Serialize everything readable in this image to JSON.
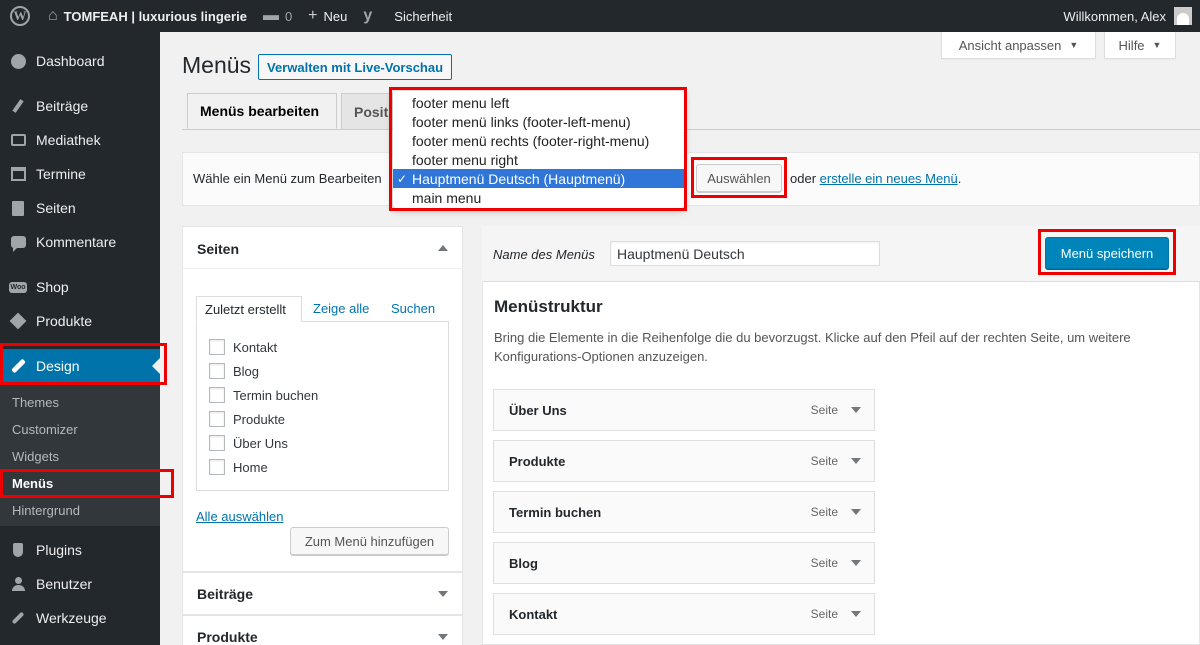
{
  "adminbar": {
    "site_name": "TOMFEAH | luxurious lingerie",
    "comments_count": "0",
    "new_label": "Neu",
    "security_label": "Sicherheit",
    "welcome": "Willkommen, Alex"
  },
  "sidebar": {
    "items": [
      {
        "label": "Dashboard",
        "icon": "dashboard-icon"
      },
      {
        "label": "Beiträge",
        "icon": "pin-icon"
      },
      {
        "label": "Mediathek",
        "icon": "media-icon"
      },
      {
        "label": "Termine",
        "icon": "calendar-icon"
      },
      {
        "label": "Seiten",
        "icon": "page-icon"
      },
      {
        "label": "Kommentare",
        "icon": "comment-icon"
      },
      {
        "label": "Shop",
        "icon": "woo-icon"
      },
      {
        "label": "Produkte",
        "icon": "product-icon"
      },
      {
        "label": "Design",
        "icon": "brush-icon"
      },
      {
        "label": "Plugins",
        "icon": "plugin-icon"
      },
      {
        "label": "Benutzer",
        "icon": "user-icon"
      },
      {
        "label": "Werkzeuge",
        "icon": "wrench-icon"
      }
    ],
    "submenu": [
      "Themes",
      "Customizer",
      "Widgets",
      "Menüs",
      "Hintergrund"
    ]
  },
  "screen": {
    "options_label": "Ansicht anpassen",
    "help_label": "Hilfe"
  },
  "header": {
    "title": "Menüs",
    "live_preview": "Verwalten mit Live-Vorschau"
  },
  "tabs": {
    "edit": "Menüs bearbeiten",
    "locations": "Positi"
  },
  "manage": {
    "label": "Wähle ein Menü zum Bearbeiten",
    "select_button": "Auswählen",
    "or_text": "oder",
    "create_link": "erstelle ein neues Menü",
    "period": "."
  },
  "dropdown": {
    "options": [
      "footer menu left",
      "footer menü links (footer-left-menu)",
      "footer menü rechts (footer-right-menu)",
      "footer menu right",
      "Hauptmenü Deutsch (Hauptmenü)",
      "main menu"
    ],
    "selected": "Hauptmenü Deutsch (Hauptmenü)",
    "check": "✓"
  },
  "pages_box": {
    "title": "Seiten",
    "tabs": [
      "Zuletzt erstellt",
      "Zeige alle",
      "Suchen"
    ],
    "items": [
      "Kontakt",
      "Blog",
      "Termin buchen",
      "Produkte",
      "Über Uns",
      "Home"
    ],
    "select_all": "Alle auswählen",
    "add_button": "Zum Menü hinzufügen"
  },
  "other_boxes": [
    "Beiträge",
    "Produkte"
  ],
  "menu_editor": {
    "name_label": "Name des Menüs",
    "name_value": "Hauptmenü Deutsch",
    "save_button": "Menü speichern",
    "structure_title": "Menüstruktur",
    "structure_desc": "Bring die Elemente in die Reihenfolge die du bevorzugst. Klicke auf den Pfeil auf der rechten Seite, um weitere Konfigurations-Optionen anzuzeigen.",
    "items": [
      {
        "title": "Über Uns",
        "type": "Seite"
      },
      {
        "title": "Produkte",
        "type": "Seite"
      },
      {
        "title": "Termin buchen",
        "type": "Seite"
      },
      {
        "title": "Blog",
        "type": "Seite"
      },
      {
        "title": "Kontakt",
        "type": "Seite"
      }
    ]
  },
  "highlight_color": "#e00000",
  "accent_color": "#0073aa"
}
